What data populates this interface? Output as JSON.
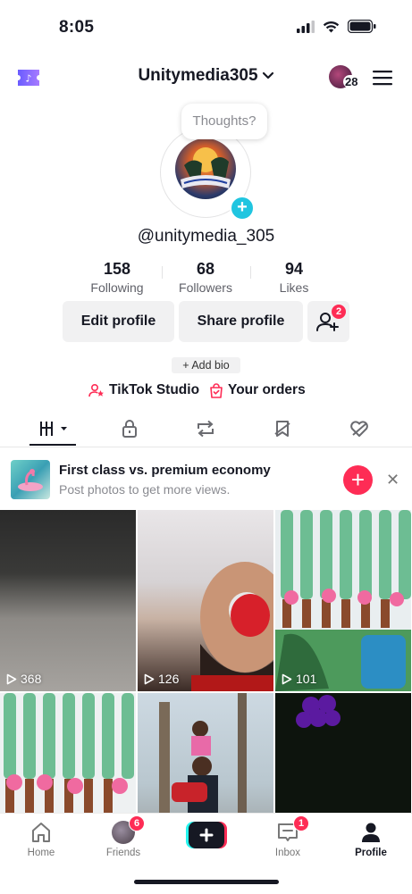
{
  "status_bar": {
    "time": "8:05"
  },
  "header": {
    "username": "Unitymedia305",
    "friend_avatar_count": "28"
  },
  "profile": {
    "thought_bubble": "Thoughts?",
    "handle": "@unitymedia_305",
    "stats": [
      {
        "value": "158",
        "label": "Following"
      },
      {
        "value": "68",
        "label": "Followers"
      },
      {
        "value": "94",
        "label": "Likes"
      }
    ],
    "edit_profile": "Edit profile",
    "share_profile": "Share profile",
    "friend_requests_badge": "2",
    "add_bio": "+ Add bio",
    "tiktok_studio": "TikTok Studio",
    "your_orders": "Your orders"
  },
  "suggestion": {
    "title": "First class vs. premium economy",
    "subtitle": "Post photos to get more views."
  },
  "videos": [
    {
      "views": "368"
    },
    {
      "views": "126"
    },
    {
      "views": "101"
    },
    {
      "views": ""
    },
    {
      "views": ""
    },
    {
      "views": ""
    }
  ],
  "nav": {
    "home": "Home",
    "friends": "Friends",
    "friends_badge": "6",
    "inbox": "Inbox",
    "inbox_badge": "1",
    "profile": "Profile"
  },
  "colors": {
    "accent": "#fe2c55",
    "teal": "#20c5e0",
    "button_bg": "#f1f1f2"
  }
}
